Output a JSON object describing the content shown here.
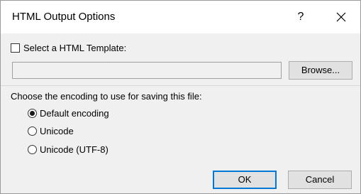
{
  "dialog": {
    "title": "HTML Output Options",
    "help_label": "?",
    "close_icon": "close-icon"
  },
  "template": {
    "checkbox_label": "Select a HTML Template:",
    "checked": false,
    "path_value": "",
    "browse_label": "Browse..."
  },
  "encoding": {
    "prompt": "Choose the encoding to use for saving this file:",
    "options": [
      {
        "label": "Default encoding",
        "checked": true
      },
      {
        "label": "Unicode",
        "checked": false
      },
      {
        "label": "Unicode (UTF-8)",
        "checked": false
      }
    ]
  },
  "buttons": {
    "ok_label": "OK",
    "cancel_label": "Cancel"
  },
  "colors": {
    "default_button_border": "#0078d7",
    "body_background": "#f0f0f0"
  }
}
